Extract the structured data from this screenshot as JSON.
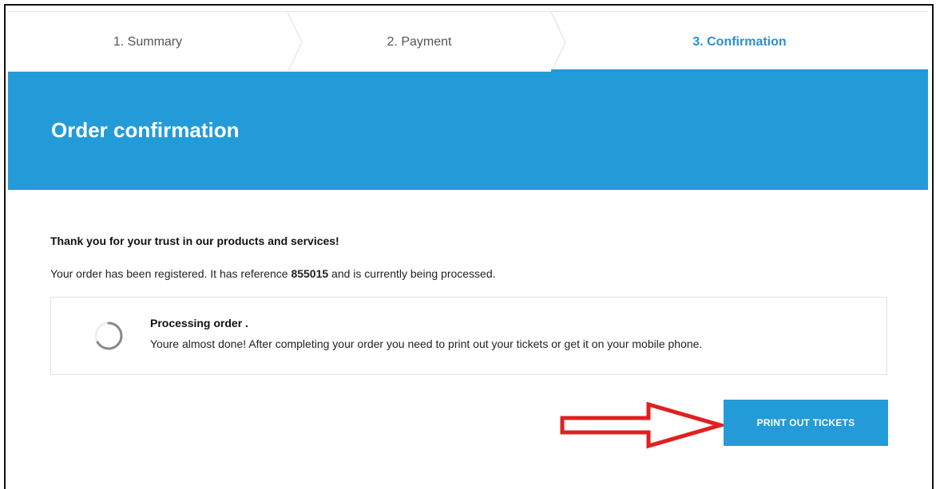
{
  "steps": [
    {
      "label": "1. Summary",
      "active": false
    },
    {
      "label": "2. Payment",
      "active": false
    },
    {
      "label": "3. Confirmation",
      "active": true
    }
  ],
  "hero": {
    "title": "Order confirmation"
  },
  "message": {
    "thanks": "Thank you for your trust in our products and services!",
    "reg_prefix": "Your order has been registered. It has reference ",
    "reference": "855015",
    "reg_suffix": " and is currently being processed."
  },
  "processing": {
    "title": "Processing order .",
    "text": "Youre almost done! After completing your order you need to print out your tickets or get it on your mobile phone.",
    "icon": "spinner-icon"
  },
  "actions": {
    "print_label": "PRINT OUT TICKETS"
  },
  "colors": {
    "accent": "#239bd8",
    "arrow": "#e02020",
    "active_step": "#2a8fd4"
  }
}
